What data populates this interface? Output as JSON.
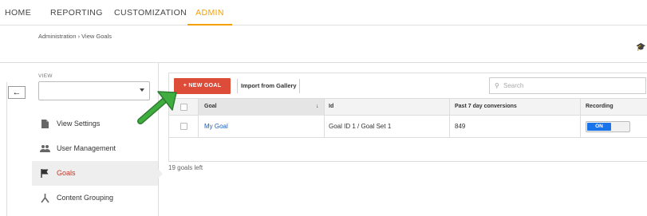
{
  "nav": {
    "tabs": [
      {
        "label": "HOME"
      },
      {
        "label": "REPORTING"
      },
      {
        "label": "CUSTOMIZATION"
      },
      {
        "label": "ADMIN"
      }
    ],
    "active_tab": "ADMIN",
    "accent_color": "#f4a100"
  },
  "breadcrumb": "Administration › View Goals",
  "sidebar": {
    "view_label": "VIEW",
    "view_value": "",
    "items": [
      {
        "label": "View Settings",
        "icon": "document-icon"
      },
      {
        "label": "User Management",
        "icon": "users-icon"
      },
      {
        "label": "Goals",
        "icon": "flag-icon",
        "active": true
      },
      {
        "label": "Content Grouping",
        "icon": "grouping-icon"
      }
    ]
  },
  "toolbar": {
    "new_goal_label": "+ NEW GOAL",
    "new_goal_color": "#dd4b39",
    "import_label": "Import from Gallery",
    "search_placeholder": "Search"
  },
  "table": {
    "headers": [
      "Goal",
      "Id",
      "Past 7 day conversions",
      "Recording"
    ],
    "rows": [
      {
        "goal": "My Goal",
        "id": "Goal ID 1 / Goal Set 1",
        "conversions": "849",
        "recording": "ON"
      }
    ]
  },
  "goals_left": "19 goals left"
}
